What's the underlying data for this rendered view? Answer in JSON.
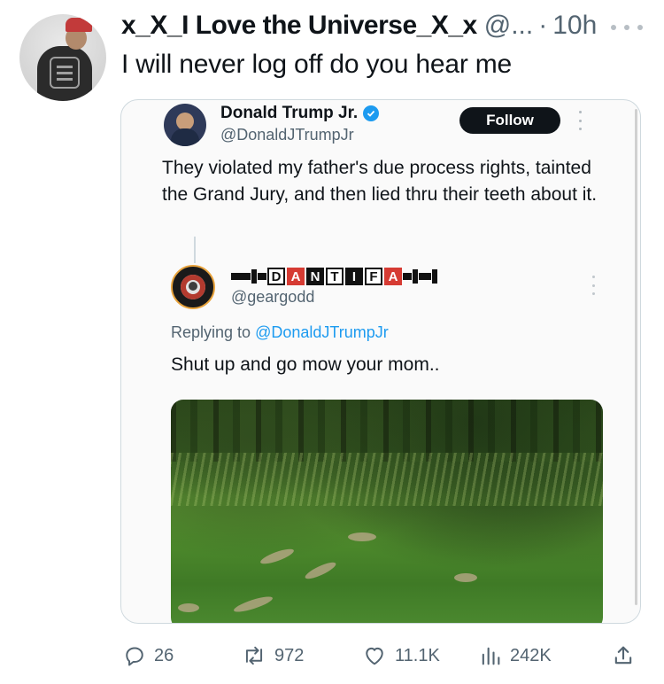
{
  "post": {
    "author_name": "x_X_I Love the Universe_X_x",
    "author_handle": "@...",
    "separator": "·",
    "time": "10h",
    "text": "I will never log off do you hear me"
  },
  "quoted_post": {
    "author_name": "Donald Trump Jr.",
    "author_handle": "@DonaldJTrumpJr",
    "follow_label": "Follow",
    "text": "They violated my father's due process rights, tainted the Grand Jury, and then lied thru their teeth about it."
  },
  "reply_post": {
    "author_name_letters": [
      "D",
      "A",
      "N",
      "T",
      "I",
      "F",
      "A"
    ],
    "author_handle": "@geargodd",
    "replying_prefix": "Replying to",
    "replying_mention": "@DonaldJTrumpJr",
    "text": "Shut up and go mow your mom.."
  },
  "actions": {
    "replies": "26",
    "reposts": "972",
    "likes": "11.1K",
    "views": "242K"
  },
  "colors": {
    "accent": "#1d9bf0",
    "text": "#0f1419",
    "muted": "#536471",
    "follow_button": "#0f1419",
    "dantifa_red": "#d63b33"
  },
  "icons": [
    "more-icon",
    "verified-icon",
    "reply-icon",
    "repost-icon",
    "like-icon",
    "views-icon",
    "share-icon"
  ]
}
